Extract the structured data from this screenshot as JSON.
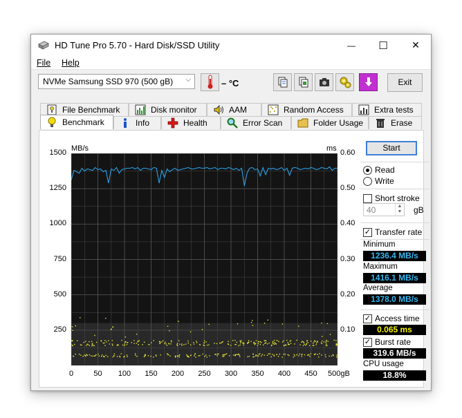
{
  "window": {
    "title": "HD Tune Pro 5.70 - Hard Disk/SSD Utility",
    "controls": {
      "minimize": "—",
      "maximize": "☐",
      "close": "✕"
    }
  },
  "menu": {
    "file": "File",
    "help": "Help"
  },
  "toolbar": {
    "drive": "NVMe   Samsung SSD 970 (500 gB)",
    "temperature": "– °C",
    "exit_label": "Exit",
    "icons": [
      "thermometer-icon",
      "copy-text-icon",
      "copy-all-icon",
      "screenshot-icon",
      "options-icon",
      "save-down-icon"
    ]
  },
  "tabs": {
    "row1": [
      {
        "label": "File Benchmark",
        "icon": "file-benchmark-icon"
      },
      {
        "label": "Disk monitor",
        "icon": "disk-monitor-icon"
      },
      {
        "label": "AAM",
        "icon": "speaker-icon"
      },
      {
        "label": "Random Access",
        "icon": "random-access-icon"
      },
      {
        "label": "Extra tests",
        "icon": "extra-tests-icon"
      }
    ],
    "row2": [
      {
        "label": "Benchmark",
        "icon": "benchmark-bulb-icon",
        "active": true
      },
      {
        "label": "Info",
        "icon": "info-icon"
      },
      {
        "label": "Health",
        "icon": "health-cross-icon"
      },
      {
        "label": "Error Scan",
        "icon": "magnifier-icon"
      },
      {
        "label": "Folder Usage",
        "icon": "folder-icon"
      },
      {
        "label": "Erase",
        "icon": "trash-icon"
      }
    ]
  },
  "chart_data": {
    "type": "line",
    "left_unit": "MB/s",
    "right_unit": "ms",
    "y_left_ticks": [
      "1500",
      "1250",
      "1000",
      "750",
      "500",
      "250"
    ],
    "y_right_ticks": [
      "0.60",
      "0.50",
      "0.40",
      "0.30",
      "0.20",
      "0.10"
    ],
    "x_ticks": [
      "0",
      "50",
      "100",
      "150",
      "200",
      "250",
      "300",
      "350",
      "400",
      "450",
      "500gB"
    ],
    "xlim": [
      0,
      500
    ],
    "ylim_left": [
      0,
      1500
    ],
    "ylim_right": [
      0,
      0.6
    ],
    "grid": true,
    "colors": {
      "transfer": "#2aa0e6",
      "access": "#e8e838",
      "background": "#141414",
      "grid": "#4a4a4a"
    },
    "series": [
      {
        "name": "Transfer rate",
        "unit": "MB/s",
        "x": [
          0,
          5,
          10,
          15,
          20,
          25,
          30,
          35,
          40,
          45,
          50,
          55,
          60,
          65,
          70,
          75,
          80,
          85,
          90,
          95,
          100,
          105,
          110,
          115,
          120,
          125,
          130,
          135,
          140,
          145,
          150,
          155,
          160,
          165,
          170,
          175,
          180,
          185,
          190,
          195,
          200,
          205,
          210,
          215,
          220,
          225,
          230,
          235,
          240,
          245,
          250,
          255,
          260,
          265,
          270,
          275,
          280,
          285,
          290,
          295,
          300,
          305,
          310,
          315,
          320,
          325,
          330,
          335,
          340,
          345,
          350,
          355,
          360,
          365,
          370,
          375,
          380,
          385,
          390,
          395,
          400,
          405,
          410,
          415,
          420,
          425,
          430,
          435,
          440,
          445,
          450,
          455,
          460,
          465,
          470,
          475,
          480,
          485,
          490,
          495,
          500
        ],
        "y": [
          1310,
          1380,
          1370,
          1360,
          1395,
          1375,
          1390,
          1385,
          1380,
          1400,
          1385,
          1390,
          1370,
          1380,
          1290,
          1390,
          1380,
          1400,
          1360,
          1385,
          1390,
          1395,
          1395,
          1400,
          1390,
          1400,
          1380,
          1395,
          1395,
          1390,
          1385,
          1400,
          1395,
          1290,
          1380,
          1330,
          1390,
          1370,
          1385,
          1395,
          1380,
          1385,
          1390,
          1395,
          1400,
          1390,
          1390,
          1395,
          1400,
          1395,
          1395,
          1400,
          1390,
          1395,
          1400,
          1385,
          1395,
          1395,
          1390,
          1400,
          1395,
          1385,
          1395,
          1380,
          1395,
          1270,
          1360,
          1395,
          1400,
          1385,
          1390,
          1340,
          1400,
          1350,
          1395,
          1390,
          1395,
          1385,
          1390,
          1400,
          1380,
          1395,
          1345,
          1395,
          1400,
          1395,
          1385,
          1390,
          1395,
          1390,
          1400,
          1395,
          1385,
          1390,
          1400,
          1395,
          1390,
          1405,
          1380,
          1395,
          1395
        ]
      },
      {
        "name": "Access time",
        "unit": "ms",
        "bands": [
          {
            "center": 0.065,
            "spread": 0.008,
            "count": 230
          },
          {
            "center": 0.03,
            "spread": 0.005,
            "count": 170
          },
          {
            "center": 0.11,
            "spread": 0.03,
            "count": 30
          }
        ]
      }
    ]
  },
  "side": {
    "start_label": "Start",
    "mode": {
      "read": "Read",
      "write": "Write",
      "selected": "read"
    },
    "short_stroke": {
      "label": "Short stroke",
      "checked": false,
      "value": "40",
      "unit": "gB"
    },
    "transfer_rate": {
      "label": "Transfer rate",
      "checked": true
    },
    "minimum": {
      "label": "Minimum",
      "value": "1236.4 MB/s",
      "color": "#35b6f0"
    },
    "maximum": {
      "label": "Maximum",
      "value": "1416.1 MB/s",
      "color": "#35b6f0"
    },
    "average": {
      "label": "Average",
      "value": "1378.0 MB/s",
      "color": "#35b6f0"
    },
    "access_time": {
      "label": "Access time",
      "checked": true,
      "value": "0.065 ms",
      "color": "#f2f200"
    },
    "burst_rate": {
      "label": "Burst rate",
      "checked": true,
      "value": "319.6 MB/s",
      "color": "#ffffff"
    },
    "cpu_usage": {
      "label": "CPU usage",
      "value": "18.8%",
      "color": "#ffffff"
    }
  }
}
